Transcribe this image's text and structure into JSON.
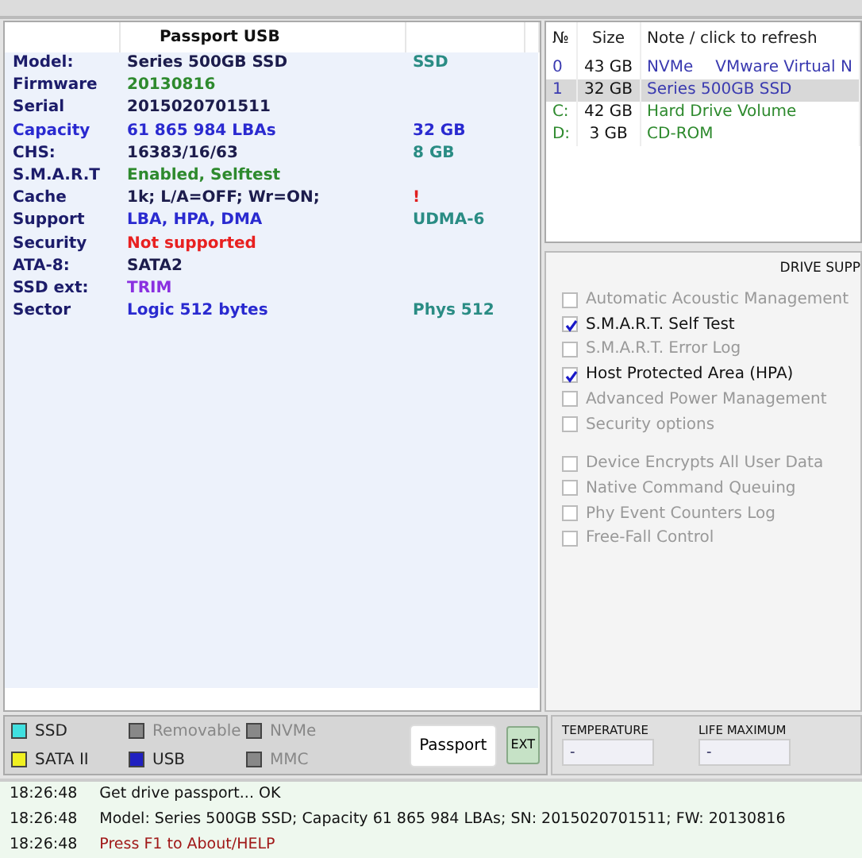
{
  "passport": {
    "header": "Passport USB",
    "rows": [
      {
        "label": {
          "text": "Model:",
          "color": "#1c1c6a"
        },
        "value": {
          "text": "Series 500GB SSD",
          "color": "#1c1c4c"
        },
        "extra": {
          "text": "SSD",
          "color": "#2a8c84"
        }
      },
      {
        "label": {
          "text": "Firmware",
          "color": "#1c1c6a"
        },
        "value": {
          "text": "20130816",
          "color": "#2e8a2e"
        }
      },
      {
        "label": {
          "text": "Serial",
          "color": "#1c1c6a"
        },
        "value": {
          "text": "2015020701511",
          "color": "#1c1c4c"
        }
      },
      {
        "label": {
          "text": "Capacity",
          "color": "#2a2ad0"
        },
        "value": {
          "text": "61 865 984 LBAs",
          "color": "#2a2ad0"
        },
        "extra": {
          "text": "32 GB",
          "color": "#2a2ad0"
        }
      },
      {
        "label": {
          "text": "CHS:",
          "color": "#1c1c6a"
        },
        "value": {
          "text": "16383/16/63",
          "color": "#1c1c4c"
        },
        "extra": {
          "text": "8 GB",
          "color": "#2a8c84"
        }
      },
      {
        "label": {
          "text": "S.M.A.R.T",
          "color": "#1c1c6a"
        },
        "value": {
          "text": "Enabled, Selftest",
          "color": "#2e8a2e"
        }
      },
      {
        "label": {
          "text": "Cache",
          "color": "#1c1c6a"
        },
        "value": {
          "text": "1k; L/A=OFF; Wr=ON;",
          "color": "#1c1c4c"
        },
        "extra": {
          "text": "!",
          "color": "#e02020"
        }
      },
      {
        "label": {
          "text": "Support",
          "color": "#1c1c6a"
        },
        "value": {
          "text": "LBA, HPA, DMA",
          "color": "#2a2ad0"
        },
        "extra": {
          "text": "UDMA-6",
          "color": "#2a8c84"
        }
      },
      {
        "label": {
          "text": "Security",
          "color": "#1c1c6a"
        },
        "value": {
          "text": "Not supported",
          "color": "#e82020"
        }
      },
      {
        "label": {
          "text": "ATA-8:",
          "color": "#1c1c6a"
        },
        "value": {
          "text": "SATA2",
          "color": "#1c1c4c"
        }
      },
      {
        "label": {
          "text": "SSD ext:",
          "color": "#1c1c6a"
        },
        "value": {
          "text": "TRIM",
          "color": "#8a30e0"
        }
      },
      {
        "label": {
          "text": "Sector",
          "color": "#1c1c6a"
        },
        "value": {
          "text": "Logic 512 bytes",
          "color": "#2a2ad0"
        },
        "extra": {
          "text": "Phys 512",
          "color": "#2a8c84"
        }
      }
    ]
  },
  "drives": {
    "columns": [
      "№",
      "Size",
      "Note / click to refresh"
    ],
    "rows": [
      {
        "num": "0",
        "size": "43 GB",
        "note": "NVMe",
        "note_2": "VMware Virtual N",
        "color": "#3a3ab0",
        "selected": false
      },
      {
        "num": "1",
        "size": "32 GB",
        "note": "Series 500GB SSD",
        "color": "#3a3ab0",
        "selected": true
      },
      {
        "num": "C:",
        "size": "42 GB",
        "note": "Hard Drive Volume",
        "color": "#2e8a2e",
        "selected": false
      },
      {
        "num": "D:",
        "size": "3 GB",
        "note": "CD-ROM",
        "color": "#2e8a2e",
        "selected": false
      }
    ]
  },
  "support": {
    "title": "DRIVE SUPP",
    "groups": [
      [
        {
          "label": "Automatic Acoustic Management",
          "checked": false,
          "disabled": true
        },
        {
          "label": "S.M.A.R.T. Self Test",
          "checked": true,
          "disabled": false
        },
        {
          "label": "S.M.A.R.T. Error Log",
          "checked": false,
          "disabled": true
        },
        {
          "label": "Host Protected Area (HPA)",
          "checked": true,
          "disabled": false
        },
        {
          "label": "Advanced Power Management",
          "checked": false,
          "disabled": true
        },
        {
          "label": "Security options",
          "checked": false,
          "disabled": true
        }
      ],
      [
        {
          "label": "Device Encrypts All User Data",
          "checked": false,
          "disabled": true
        },
        {
          "label": "Native Command Queuing",
          "checked": false,
          "disabled": true
        },
        {
          "label": "Phy Event Counters Log",
          "checked": false,
          "disabled": true
        },
        {
          "label": "Free-Fall Control",
          "checked": false,
          "disabled": true
        }
      ]
    ]
  },
  "legend": [
    {
      "label": "SSD",
      "color": "#40e0e0",
      "disabled": false
    },
    {
      "label": "Removable",
      "color": "#888888",
      "disabled": true
    },
    {
      "label": "NVMe",
      "color": "#888888",
      "disabled": true
    },
    {
      "label": "SATA II",
      "color": "#f0f020",
      "disabled": false
    },
    {
      "label": "USB",
      "color": "#2020c0",
      "disabled": false
    },
    {
      "label": "MMC",
      "color": "#888888",
      "disabled": true
    }
  ],
  "buttons": [
    {
      "label": "Passport",
      "kind": "plain"
    },
    {
      "label": "EXT",
      "kind": "green"
    }
  ],
  "gauges": [
    {
      "label": "TEMPERATURE",
      "value": "-"
    },
    {
      "label": "LIFE MAXIMUM",
      "value": "-"
    }
  ],
  "log": [
    {
      "time": "18:26:48",
      "message": "Get drive passport... OK",
      "kind": "info"
    },
    {
      "time": "18:26:48",
      "message": "Model: Series 500GB SSD; Capacity 61 865 984 LBAs; SN: 2015020701511; FW: 20130816",
      "kind": "info"
    },
    {
      "time": "18:26:48",
      "message": "Press F1 to About/HELP",
      "kind": "error"
    }
  ]
}
